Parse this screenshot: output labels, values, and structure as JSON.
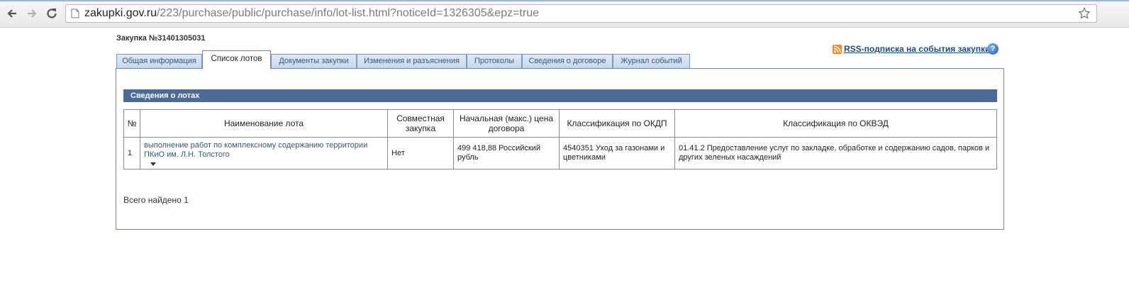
{
  "browser": {
    "url_host": "zakupki.gov.ru",
    "url_path": "/223/purchase/public/purchase/info/lot-list.html?noticeId=1326305&epz=true"
  },
  "page": {
    "purchase_title": "Закупка №31401305031",
    "rss_label": "RSS-подписка на события закупки",
    "help_label": "?"
  },
  "tabs": [
    {
      "label": "Общая информация",
      "active": false
    },
    {
      "label": "Список лотов",
      "active": true
    },
    {
      "label": "Документы закупки",
      "active": false
    },
    {
      "label": "Изменения и разъяснения",
      "active": false
    },
    {
      "label": "Протоколы",
      "active": false
    },
    {
      "label": "Сведения о договоре",
      "active": false
    },
    {
      "label": "Журнал событий",
      "active": false
    }
  ],
  "section": {
    "title": "Сведения о лотах"
  },
  "table": {
    "headers": [
      "№",
      "Наименование лота",
      "Совместная закупка",
      "Начальная (макс.) цена договора",
      "Классификация по ОКДП",
      "Классификация по ОКВЭД"
    ],
    "rows": [
      {
        "num": "1",
        "name": "выполнение работ по комплексному содержанию территории ПКиО им. Л.Н. Толстого",
        "joint": "Нет",
        "price": "499 418,88 Российский рубль",
        "okdp": "4540351 Уход за газонами и цветниками",
        "okved": "01.41.2 Предоставление услуг по закладке, обработке и содержанию садов, парков и других зеленых насаждений"
      }
    ]
  },
  "footer": {
    "total": "Всего найдено 1"
  },
  "colors": {
    "tab_bg": "#c7d8ec",
    "section_header": "#4b6c98",
    "link": "#35577f",
    "rss_link": "#1d4a86"
  }
}
